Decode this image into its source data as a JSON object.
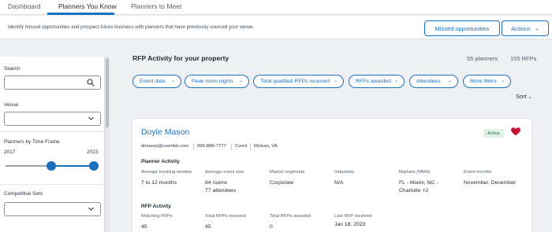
{
  "nav": {
    "tabs": [
      {
        "label": "Dashboard"
      },
      {
        "label": "Planners You Know"
      },
      {
        "label": "Planners to Meet"
      }
    ]
  },
  "header": {
    "subtitle": "Identify missed opportunities and prospect future business with planners that have previously sourced your venue.",
    "missed_label": "Missed opportunities",
    "actions_label": "Actions"
  },
  "sidebar": {
    "search_label": "Search",
    "search_value": "",
    "venue_label": "Venue",
    "timeframe_label": "Planners by Time Frame",
    "year_start": "2017",
    "year_end": "2023",
    "competitive_label": "Competitive Sets",
    "icons": {
      "search": "search-icon",
      "chevron": "chevron-down-icon"
    }
  },
  "main": {
    "title": "RFP Activity for your property",
    "planners_count": "55 planners",
    "rfps_count": "155 RFPs",
    "filters": [
      {
        "label": "Event date"
      },
      {
        "label": "Peak room nights"
      },
      {
        "label": "Total qualified RFPs received"
      },
      {
        "label": "RFPs awarded"
      },
      {
        "label": "Attendees"
      },
      {
        "label": "More filters"
      }
    ],
    "sort_label": "Sort"
  },
  "card": {
    "name": "Doyle Mason",
    "status": "Active",
    "email": "dmason@cventkb.com",
    "phone": "999-888-7777",
    "company": "Cvent",
    "location": "Mclean, VA",
    "planner_activity": {
      "title": "Planner Activity",
      "columns": [
        {
          "header": "Average booking window",
          "value": "7 to 12 months"
        },
        {
          "header": "Average event size",
          "value": "84 rooms",
          "value2": "77 attendees"
        },
        {
          "header": "Market segments",
          "value": "Corporate"
        },
        {
          "header": "Industries",
          "value": "N/A"
        },
        {
          "header": "Markets (MMA)",
          "value": "FL - Miami, NC -",
          "value2": "Charlotte +2"
        },
        {
          "header": "Event months",
          "value": "November, December"
        }
      ]
    },
    "rfp_activity": {
      "title": "RFP Activity",
      "columns": [
        {
          "header": "Matching RFPs",
          "value": "45"
        },
        {
          "header": "Total RFPs received",
          "value": "45"
        },
        {
          "header": "Total RFPs awarded",
          "value": "0"
        },
        {
          "header": "Last RFP received",
          "value": "Jan 18, 2023"
        }
      ]
    }
  },
  "colors": {
    "accent": "#1a6fbf",
    "heart": "#c8102e",
    "active_bg": "#dff1e4"
  }
}
